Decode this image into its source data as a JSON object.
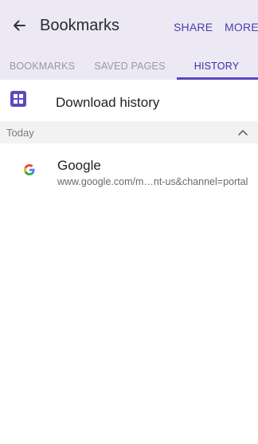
{
  "appbar": {
    "title": "Bookmarks",
    "share_label": "SHARE",
    "more_label": "MORE",
    "back_icon": "arrow-left-icon"
  },
  "tabs": [
    {
      "label": "BOOKMARKS",
      "selected": false
    },
    {
      "label": "SAVED PAGES",
      "selected": false
    },
    {
      "label": "HISTORY",
      "selected": true
    }
  ],
  "download_history": {
    "label": "Download history",
    "icon": "download-grid-icon"
  },
  "section": {
    "label": "Today",
    "collapse_icon": "chevron-up-icon"
  },
  "history_items": [
    {
      "title": "Google",
      "url": "www.google.com/m…nt-us&channel=portal",
      "icon": "google-g-icon"
    }
  ],
  "colors": {
    "accent": "#4a3ea8",
    "header_bg": "#ece9f5",
    "section_bg": "#f2f2f2"
  }
}
